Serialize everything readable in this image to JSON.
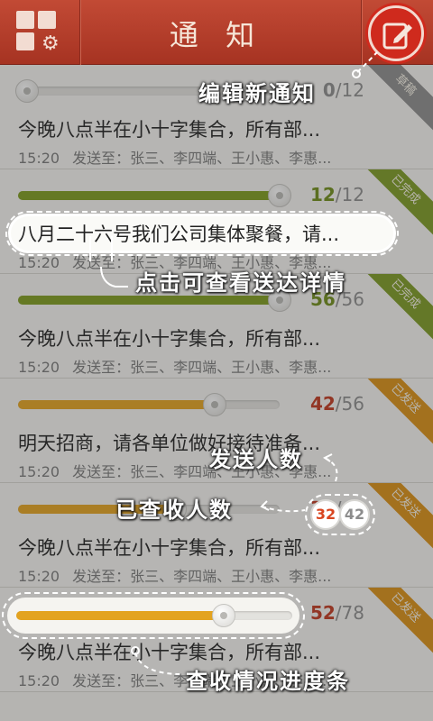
{
  "header": {
    "title": "通 知",
    "menu_icon": "grid-settings-icon",
    "edit_icon": "pencil-edit-icon"
  },
  "messages": [
    {
      "status": "草稿",
      "status_color": "#8c8c8c",
      "fill_color": "#d8d7d3",
      "progress": 0.0,
      "seen": "0",
      "total": "12",
      "seen_color": "#8c8c8c",
      "text": "今晚八点半在小十字集合，所有部...",
      "time": "15:20",
      "recipients": "发送至：张三、李四端、王小惠、李惠..."
    },
    {
      "status": "已完成",
      "status_color": "#7c9a24",
      "fill_color": "#7e9b1e",
      "progress": 1.0,
      "seen": "12",
      "total": "12",
      "seen_color": "#6f8d1a",
      "text": "八月二十六号我们公司集体聚餐，请...",
      "time": "15:20",
      "recipients": "发送至：张三、李四端、王小惠、李惠..."
    },
    {
      "status": "已完成",
      "status_color": "#7c9a24",
      "fill_color": "#7e9b1e",
      "progress": 1.0,
      "seen": "56",
      "total": "56",
      "seen_color": "#6f8d1a",
      "text": "今晚八点半在小十字集合，所有部...",
      "time": "15:20",
      "recipients": "发送至：张三、李四端、王小惠、李惠..."
    },
    {
      "status": "已发送",
      "status_color": "#d98f16",
      "fill_color": "#e3a320",
      "progress": 0.75,
      "seen": "42",
      "total": "56",
      "seen_color": "#c0391f",
      "text": "明天招商，请各单位做好接待准备...",
      "time": "15:20",
      "recipients": "发送至：张三、李四端、王小惠、李惠..."
    },
    {
      "status": "已发送",
      "status_color": "#d98f16",
      "fill_color": "#e3a320",
      "progress": 0.6,
      "seen": "32",
      "total": "42",
      "seen_color": "#c0391f",
      "text": "今晚八点半在小十字集合，所有部...",
      "time": "15:20",
      "recipients": "发送至：张三、李四端、王小惠、李惠..."
    },
    {
      "status": "已发送",
      "status_color": "#d98f16",
      "fill_color": "#e3a320",
      "progress": 0.75,
      "seen": "52",
      "total": "78",
      "seen_color": "#c0391f",
      "text": "今晚八点半在小十字集合，所有部...",
      "time": "15:20",
      "recipients": "发送至：张三、李四端、王小惠、李惠..."
    }
  ],
  "guide": {
    "edit_new": "编辑新通知",
    "tap_detail": "点击可查看送达详情",
    "sent_count": "发送人数",
    "seen_count": "已查收人数",
    "progress_bar": "查收情况进度条",
    "badge_seen": "32",
    "badge_total": "42",
    "badge_seen_color": "#d9451f",
    "badge_total_color": "#8c8c8c"
  }
}
